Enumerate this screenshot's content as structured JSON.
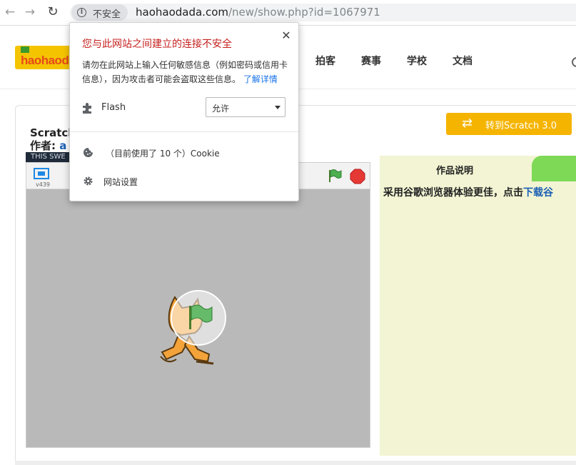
{
  "browser": {
    "security_label": "不安全",
    "url_host": "haohaodada.com",
    "url_path": "/new/show.php?id=1067971"
  },
  "site": {
    "logo_text": "haohaoda",
    "nav": [
      "拍客",
      "赛事",
      "学校",
      "文档"
    ]
  },
  "project": {
    "title": "Scratch",
    "author_label": "作者:",
    "author_name": "a",
    "switch_button": "转到Scratch 3.0",
    "strip_text": "THIS SWE",
    "version": "v439"
  },
  "description": {
    "tab_label": "作品说明",
    "text_prefix": "采用谷歌浏览器体验更佳，点击",
    "link_text": "下载谷"
  },
  "popup": {
    "title": "您与此网站之间建立的连接不安全",
    "body": "请勿在此网站上输入任何敏感信息（例如密码或信用卡信息），因为攻击者可能会盗取这些信息。",
    "learn_more": "了解详情",
    "permission_label": "Flash",
    "permission_value": "允许",
    "cookie_text": "（目前使用了 10 个）Cookie",
    "settings_text": "网站设置"
  },
  "colors": {
    "warning_red": "#c5221f",
    "link_blue": "#1a73e8",
    "switch_button_bg": "#f5b400",
    "description_bg": "#f2f4d3",
    "green_tab": "#7ed957"
  }
}
